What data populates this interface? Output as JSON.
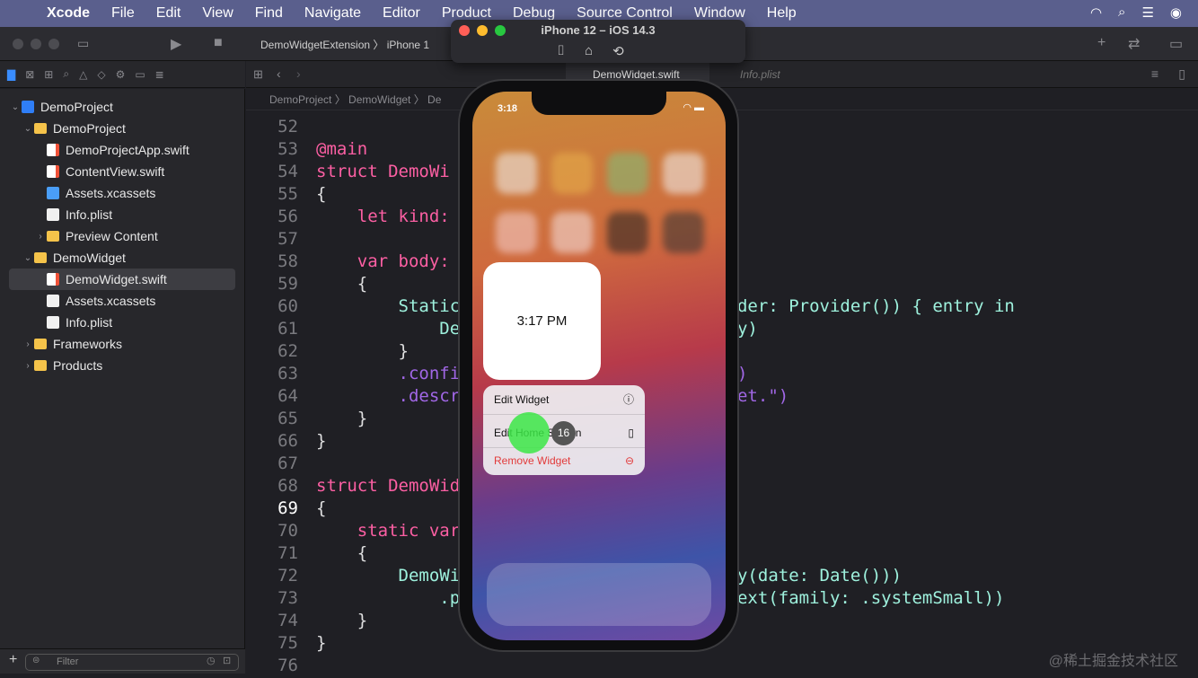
{
  "menubar": {
    "app": "Xcode",
    "items": [
      "File",
      "Edit",
      "View",
      "Find",
      "Navigate",
      "Editor",
      "Product",
      "Debug",
      "Source Control",
      "Window",
      "Help"
    ]
  },
  "toolbar": {
    "scheme": "DemoWidgetExtension",
    "device": "iPhone 1"
  },
  "editor_tabs": {
    "active": "DemoWidget.swift",
    "inactive": "Info.plist"
  },
  "breadcrumb": "DemoProject 〉 DemoWidget 〉 De",
  "navigator": {
    "items": [
      {
        "label": "DemoProject",
        "icon": "project-icon",
        "chevron": "⌄"
      },
      {
        "label": "DemoProject",
        "icon": "folder-icon",
        "chevron": "⌄"
      },
      {
        "label": "DemoProjectApp.swift",
        "icon": "swift-file-icon",
        "chevron": ""
      },
      {
        "label": "ContentView.swift",
        "icon": "swift-file-icon",
        "chevron": ""
      },
      {
        "label": "Assets.xcassets",
        "icon": "assets-icon",
        "chevron": ""
      },
      {
        "label": "Info.plist",
        "icon": "plist-icon",
        "chevron": ""
      },
      {
        "label": "Preview Content",
        "icon": "folder-icon",
        "chevron": "›"
      },
      {
        "label": "DemoWidget",
        "icon": "folder-icon",
        "chevron": "⌄"
      },
      {
        "label": "DemoWidget.swift",
        "icon": "swift-file-icon",
        "chevron": ""
      },
      {
        "label": "Assets.xcassets",
        "icon": "assets-icon",
        "chevron": ""
      },
      {
        "label": "Info.plist",
        "icon": "plist-icon",
        "chevron": ""
      },
      {
        "label": "Frameworks",
        "icon": "folder-icon",
        "chevron": "›"
      },
      {
        "label": "Products",
        "icon": "folder-icon",
        "chevron": "›"
      }
    ],
    "selected_index": 8
  },
  "filter": {
    "placeholder": "Filter"
  },
  "code": {
    "current_line": "69",
    "lines": [
      {
        "n": "52",
        "t": ""
      },
      {
        "n": "53",
        "t": "@main"
      },
      {
        "n": "54",
        "t": "struct DemoWi"
      },
      {
        "n": "55",
        "t": "{"
      },
      {
        "n": "56",
        "t": "    let kind:"
      },
      {
        "n": "57",
        "t": ""
      },
      {
        "n": "58",
        "t": "    var body:"
      },
      {
        "n": "59",
        "t": "    {"
      },
      {
        "n": "60",
        "t": "        Static                      provider: Provider()) { entry in"
      },
      {
        "n": "61",
        "t": "            De                        ntry)"
      },
      {
        "n": "62",
        "t": "        }"
      },
      {
        "n": "63",
        "t": "        .confi                      dget\")"
      },
      {
        "n": "64",
        "t": "        .descr                       widget.\")"
      },
      {
        "n": "65",
        "t": "    }"
      },
      {
        "n": "66",
        "t": "}"
      },
      {
        "n": "67",
        "t": ""
      },
      {
        "n": "68",
        "t": "struct DemoWid                       der"
      },
      {
        "n": "69",
        "t": "{"
      },
      {
        "n": "70",
        "t": "    static var"
      },
      {
        "n": "71",
        "t": "    {"
      },
      {
        "n": "72",
        "t": "        DemoWi                      eEntry(date: Date()))"
      },
      {
        "n": "73",
        "t": "            .p                      wContext(family: .systemSmall))"
      },
      {
        "n": "74",
        "t": "    }"
      },
      {
        "n": "75",
        "t": "}"
      },
      {
        "n": "76",
        "t": ""
      }
    ]
  },
  "simulator": {
    "title": "iPhone 12 – iOS 14.3",
    "status_time": "3:18",
    "widget_time": "3:17 PM",
    "menu": [
      {
        "label": "Edit Widget",
        "icon": "ⓘ"
      },
      {
        "label": "Edit Home Screen",
        "icon": "▯"
      },
      {
        "label": "Remove Widget",
        "icon": "⊖"
      }
    ]
  },
  "touch_counter": "16",
  "watermark": "@稀土掘金技术社区",
  "colors": {
    "menubar": "#5a5f8d",
    "background": "#1f1f24",
    "keyword": "#fc5fa3",
    "type": "#5dd8ff",
    "string": "#fc6a5d",
    "touch": "#3ce646"
  }
}
